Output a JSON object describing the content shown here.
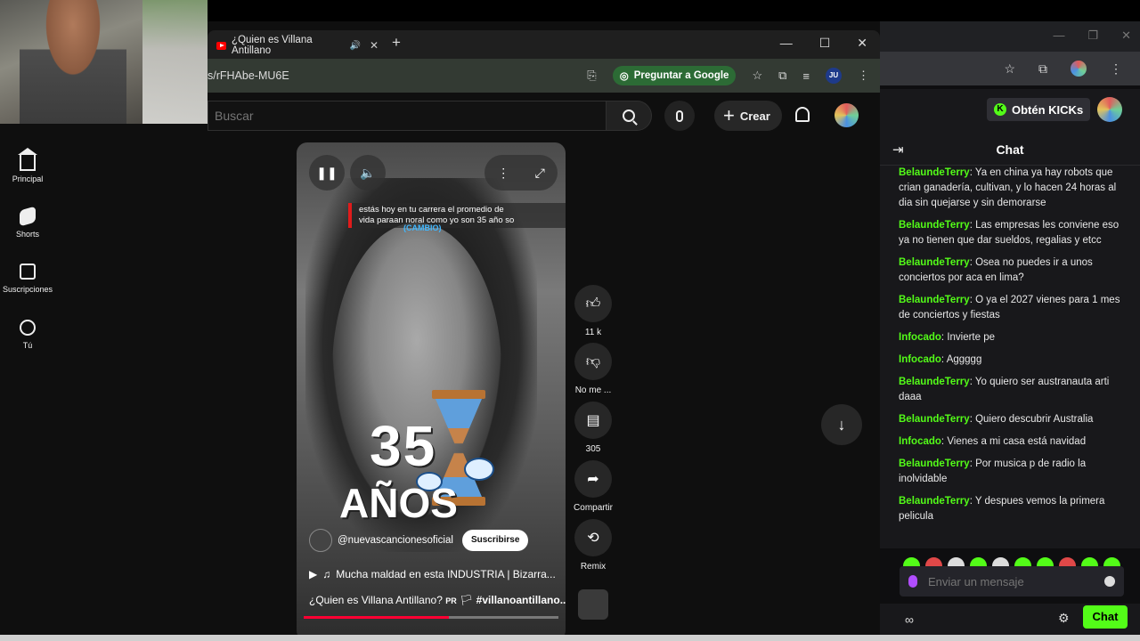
{
  "browser_left": {
    "tab_title": "¿Quien es Villana Antillano",
    "url": "s/rFHAbe-MU6E",
    "ask_google_label": "Preguntar a Google",
    "profile_initials": "JU"
  },
  "youtube": {
    "search_placeholder": "Buscar",
    "create_label": "Crear",
    "sidebar": [
      {
        "label": "Principal",
        "icon": "home-icon"
      },
      {
        "label": "Shorts",
        "icon": "shorts-icon"
      },
      {
        "label": "Suscripciones",
        "icon": "subscriptions-icon"
      },
      {
        "label": "Tú",
        "icon": "you-icon"
      }
    ],
    "short": {
      "caption_line1": "estás hoy en tu carrera el promedio de",
      "caption_line2": "vida paraan noral como yo son 35 año so",
      "caption_blue": "(CAMBIO)",
      "overlay_number": "35",
      "overlay_word": "AÑOS",
      "channel": "@nuevascancionesoficial",
      "subscribe_label": "Suscribirse",
      "music": "Mucha maldad en esta INDUSTRIA | Bizarra...",
      "title_prefix": "¿Quien es Villana Antillano?",
      "title_pr": "PR",
      "title_hashtag": "#villanoantillano...",
      "progress_fraction": 0.57
    },
    "actions": {
      "like_count": "11 k",
      "dislike_label": "No me ...",
      "comments_count": "305",
      "share_label": "Compartir",
      "remix_label": "Remix"
    }
  },
  "kick": {
    "obten_label": "Obtén KICKs",
    "chat_title": "Chat",
    "messages": [
      {
        "user": "BelaundeTerry",
        "text": "Ya en china ya hay robots que crian ganadería, cultivan, y lo hacen 24 horas al dia sin quejarse y sin demorarse"
      },
      {
        "user": "BelaundeTerry",
        "text": "Las empresas les conviene eso ya no tienen que dar sueldos, regalias y etcc"
      },
      {
        "user": "BelaundeTerry",
        "text": "Osea no puedes ir a unos conciertos por aca en lima?"
      },
      {
        "user": "BelaundeTerry",
        "text": "O ya el 2027 vienes para 1 mes de conciertos y fiestas"
      },
      {
        "user": "Infocado",
        "text": "Invierte pe"
      },
      {
        "user": "Infocado",
        "text": "Aggggg"
      },
      {
        "user": "BelaundeTerry",
        "text": "Yo quiero ser austranauta arti daaa"
      },
      {
        "user": "BelaundeTerry",
        "text": "Quiero descubrir Australia"
      },
      {
        "user": "Infocado",
        "text": "Vienes a mi casa está navidad"
      },
      {
        "user": "BelaundeTerry",
        "text": "Por musica p de radio la inolvidable"
      },
      {
        "user": "BelaundeTerry",
        "text": "Y despues vemos la primera pelicula"
      }
    ],
    "input_placeholder": "Enviar un mensaje",
    "send_label": "Chat",
    "footer_icons": "∞"
  },
  "colors": {
    "kick_green": "#53fc18",
    "yt_red": "#ff0000",
    "bg": "#0f0f0f"
  }
}
